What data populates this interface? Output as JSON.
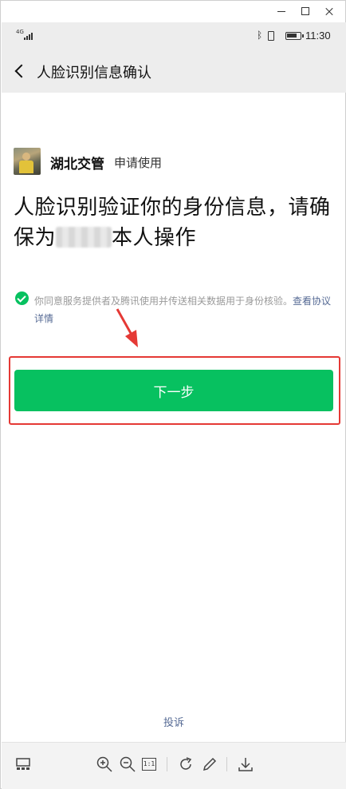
{
  "status_bar": {
    "network": "4G",
    "time": "11:30"
  },
  "header": {
    "title": "人脸识别信息确认"
  },
  "requester": {
    "name": "湖北交管",
    "action": "申请使用"
  },
  "headline": {
    "part1": "人脸识别验证你的身份信息，请确保为",
    "part2": "本人操作"
  },
  "consent": {
    "text": "你同意服务提供者及腾讯使用并传送相关数据用于身份核验。",
    "link": "查看协议详情"
  },
  "primary_button": {
    "label": "下一步"
  },
  "footer": {
    "complain": "投诉"
  },
  "toolbar": {
    "actual_size_label": "1:1"
  },
  "colors": {
    "accent_green": "#07c160",
    "link_blue": "#576b95",
    "annotation_red": "#e53935",
    "header_bg": "#ededed"
  },
  "icons": [
    "back-icon",
    "check-icon",
    "bluetooth-icon",
    "battery-icon",
    "zoom-in-icon",
    "zoom-out-icon",
    "rotate-icon",
    "edit-icon",
    "download-icon",
    "gallery-icon"
  ]
}
